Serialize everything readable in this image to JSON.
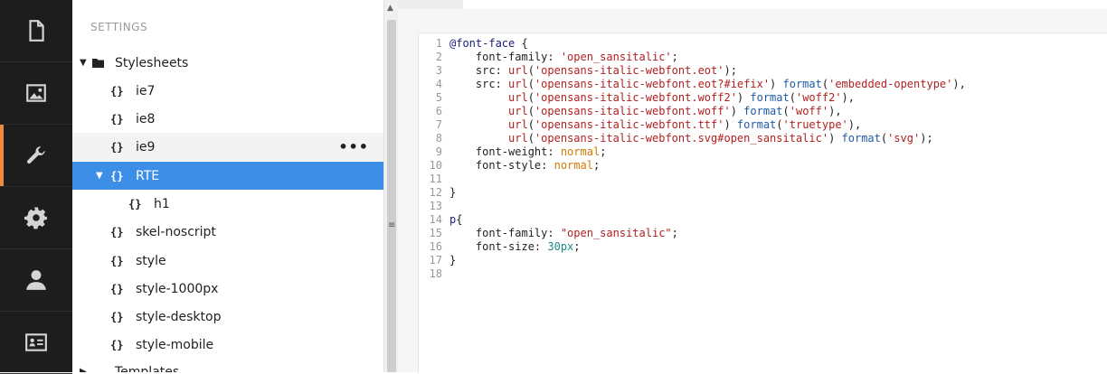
{
  "sidebar": {
    "sections": [
      {
        "icon": "document-icon",
        "name": "content"
      },
      {
        "icon": "image-icon",
        "name": "media"
      },
      {
        "icon": "wrench-icon",
        "name": "settings",
        "active": true
      },
      {
        "icon": "gear-icon",
        "name": "developer"
      },
      {
        "icon": "user-icon",
        "name": "users"
      },
      {
        "icon": "id-card-icon",
        "name": "members"
      }
    ]
  },
  "tree": {
    "header": "SETTINGS",
    "stylesheets_label": "Stylesheets",
    "items": {
      "ie7": "ie7",
      "ie8": "ie8",
      "ie9": "ie9",
      "rte": "RTE",
      "h1": "h1",
      "skel_noscript": "skel-noscript",
      "style": "style",
      "style_1000px": "style-1000px",
      "style_desktop": "style-desktop",
      "style_mobile": "style-mobile"
    },
    "templates_label": "Templates",
    "more_menu": "•••",
    "brace_icon": "{}"
  },
  "editor": {
    "line_numbers": [
      "1",
      "2",
      "3",
      "4",
      "5",
      "6",
      "7",
      "8",
      "9",
      "10",
      "11",
      "12",
      "13",
      "14",
      "15",
      "16",
      "17",
      "18"
    ],
    "code": {
      "l1a": "@font-face",
      "l1b": " {",
      "l2a": "    font-family: ",
      "l2b": "'open_sansitalic'",
      "l2c": ";",
      "l3a": "    src: ",
      "l3b": "url",
      "l3c": "(",
      "l3d": "'opensans-italic-webfont.eot'",
      "l3e": ");",
      "l4a": "    src: ",
      "l4b": "url",
      "l4c": "(",
      "l4d": "'opensans-italic-webfont.eot?#iefix'",
      "l4e": ") ",
      "l4f": "format",
      "l4g": "(",
      "l4h": "'embedded-opentype'",
      "l4i": "),",
      "l5a": "         ",
      "l5b": "url",
      "l5c": "(",
      "l5d": "'opensans-italic-webfont.woff2'",
      "l5e": ") ",
      "l5f": "format",
      "l5g": "(",
      "l5h": "'woff2'",
      "l5i": "),",
      "l6a": "         ",
      "l6b": "url",
      "l6c": "(",
      "l6d": "'opensans-italic-webfont.woff'",
      "l6e": ") ",
      "l6f": "format",
      "l6g": "(",
      "l6h": "'woff'",
      "l6i": "),",
      "l7a": "         ",
      "l7b": "url",
      "l7c": "(",
      "l7d": "'opensans-italic-webfont.ttf'",
      "l7e": ") ",
      "l7f": "format",
      "l7g": "(",
      "l7h": "'truetype'",
      "l7i": "),",
      "l8a": "         ",
      "l8b": "url",
      "l8c": "(",
      "l8d": "'opensans-italic-webfont.svg#open_sansitalic'",
      "l8e": ") ",
      "l8f": "format",
      "l8g": "(",
      "l8h": "'svg'",
      "l8i": ");",
      "l9a": "    font-weight: ",
      "l9b": "normal",
      "l9c": ";",
      "l10a": "    font-style: ",
      "l10b": "normal",
      "l10c": ";",
      "l12": "}",
      "l14a": "p",
      "l14b": "{",
      "l15a": "    font-family: ",
      "l15b": "\"open_sansitalic\"",
      "l15c": ";",
      "l16a": "    font-size: ",
      "l16b": "30px",
      "l16c": ";",
      "l17": "}"
    }
  },
  "colors": {
    "sidebar_bg": "#1d1d1d",
    "active_accent": "#f08b3e",
    "selected_row": "#3c8ee6"
  }
}
